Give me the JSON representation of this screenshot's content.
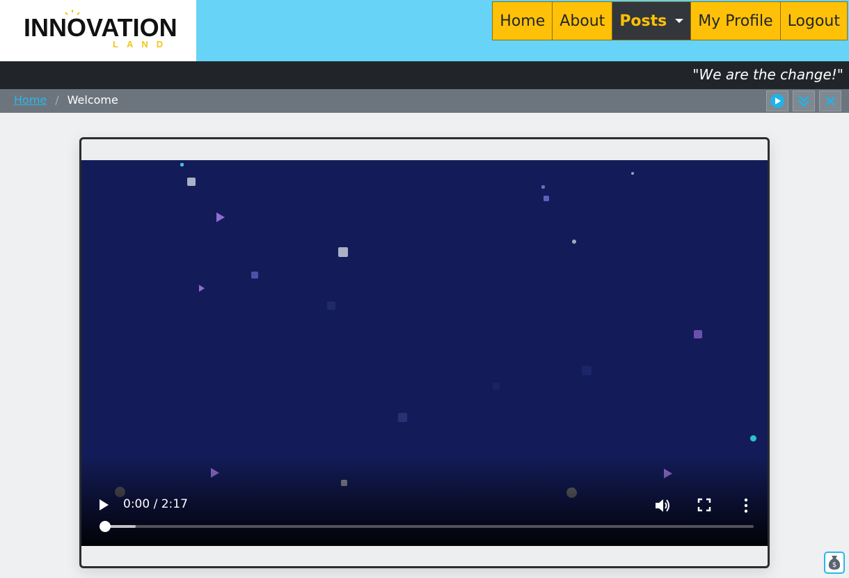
{
  "brand": {
    "logo_main": "INNOVATION",
    "logo_sub": "LAND",
    "accent": "#ffc107",
    "header_bg": "#66d3f7"
  },
  "nav": {
    "items": [
      {
        "label": "Home",
        "active": false
      },
      {
        "label": "About",
        "active": false
      },
      {
        "label": "Posts",
        "active": true,
        "dropdown": true
      },
      {
        "label": "My Profile",
        "active": false
      },
      {
        "label": "Logout",
        "active": false
      }
    ]
  },
  "slogan": "\"We are the change!\"",
  "breadcrumb": {
    "home": "Home",
    "separator": "/",
    "current": "Welcome",
    "tools": [
      "play-circle-icon",
      "double-chevron-down-icon",
      "close-icon"
    ]
  },
  "video": {
    "time": "0:00 / 2:17",
    "progress": 0.0,
    "buffered": 0.053,
    "bg_color": "#131c58",
    "controls": [
      "play-icon",
      "volume-icon",
      "fullscreen-icon",
      "more-vert-icon"
    ]
  },
  "floating": {
    "icon": "money-bag-icon"
  }
}
